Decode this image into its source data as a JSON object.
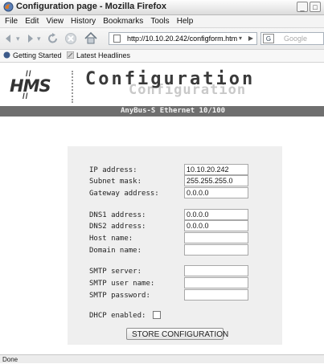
{
  "window": {
    "title": "Configuration page - Mozilla Firefox",
    "minimize": "_",
    "maximize": "□"
  },
  "menu": [
    "File",
    "Edit",
    "View",
    "History",
    "Bookmarks",
    "Tools",
    "Help"
  ],
  "nav": {
    "url": "http://10.10.20.242/configform.htm",
    "search_placeholder": "Google",
    "search_engine_icon": "G"
  },
  "bookmarks": {
    "items": [
      "Getting Started",
      "Latest Headlines"
    ]
  },
  "header": {
    "logo": "HMS",
    "title": "Configuration",
    "title_shadow": "Configuration",
    "subtitle": "AnyBus-S Ethernet 10/100"
  },
  "form": {
    "ip_label": "IP address:",
    "ip_value": "10.10.20.242",
    "subnet_label": "Subnet mask:",
    "subnet_value": "255.255.255.0",
    "gateway_label": "Gateway address:",
    "gateway_value": "0.0.0.0",
    "dns1_label": "DNS1 address:",
    "dns1_value": "0.0.0.0",
    "dns2_label": "DNS2 address:",
    "dns2_value": "0.0.0.0",
    "host_label": "Host name:",
    "host_value": "",
    "domain_label": "Domain name:",
    "domain_value": "",
    "smtp_server_label": "SMTP server:",
    "smtp_server_value": "",
    "smtp_user_label": "SMTP user name:",
    "smtp_user_value": "",
    "smtp_pass_label": "SMTP password:",
    "smtp_pass_value": "",
    "dhcp_label": "DHCP enabled:",
    "dhcp_checked": false,
    "submit_label": "STORE CONFIGURATION"
  },
  "status": {
    "text": "Done"
  }
}
